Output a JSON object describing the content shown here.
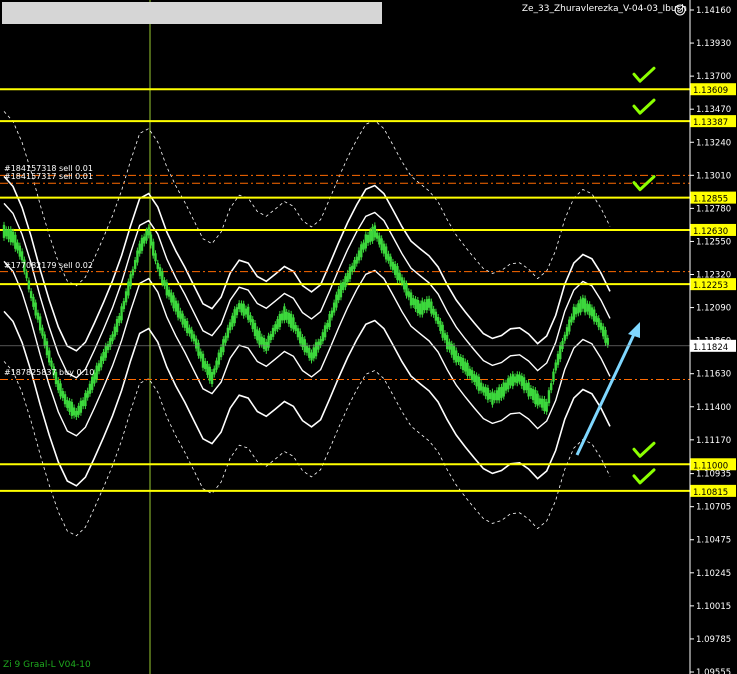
{
  "window": {
    "title": "Ze_33_Zhuravlerezka_V-04-03_Ibush",
    "indicator_label": "Zi 9 Graal-L V04-10"
  },
  "orders": [
    {
      "label": "#184157318 sell 0.01",
      "price": 1.1301
    },
    {
      "label": "#184157317 sell 0.01",
      "price": 1.12955
    },
    {
      "label": "#177082179 sell 0.02",
      "price": 1.1234
    },
    {
      "label": "#187825837 buy 0.10",
      "price": 1.1159
    }
  ],
  "price_axis": {
    "ticks": [
      "1.14160",
      "1.13930",
      "1.13700",
      "1.13470",
      "1.13240",
      "1.13010",
      "1.12780",
      "1.12550",
      "1.12320",
      "1.12090",
      "1.11860",
      "1.11630",
      "1.11400",
      "1.11170",
      "1.10935",
      "1.10705",
      "1.10475",
      "1.10245",
      "1.10015",
      "1.09785",
      "1.09555"
    ],
    "current_price": "1.11824"
  },
  "levels": [
    {
      "price": 1.13609,
      "label": "1.13609",
      "check": true
    },
    {
      "price": 1.13387,
      "label": "1.13387",
      "check": true
    },
    {
      "price": 1.12855,
      "label": "1.12855",
      "check": true
    },
    {
      "price": 1.1263,
      "label": "1.12630",
      "check": false
    },
    {
      "price": 1.12253,
      "label": "1.12253",
      "check": false
    },
    {
      "price": 1.11,
      "label": "1.11000",
      "check": true
    },
    {
      "price": 1.10815,
      "label": "1.10815",
      "check": true
    }
  ],
  "colors": {
    "background": "#000000",
    "candle": "#3cd83c",
    "level_line": "#ffff00",
    "level_label_bg": "#ffff00",
    "band": "#ffffff",
    "order_line": "#ff6a00",
    "arrow": "#7fd7ff",
    "checkmark": "#8cff00",
    "vline": "#9acd32"
  },
  "chart_data": {
    "type": "line",
    "title": "",
    "ylabel": "",
    "ylim": [
      1.09555,
      1.1416
    ],
    "series": [
      {
        "values": [
          1.1262,
          1.1258,
          1.1245,
          1.1218,
          1.1198,
          1.1175,
          1.1155,
          1.1142,
          1.1135,
          1.1145,
          1.116,
          1.1175,
          1.1188,
          1.1205,
          1.1228,
          1.125,
          1.1262,
          1.1238,
          1.1222,
          1.121,
          1.1198,
          1.1188,
          1.1172,
          1.116,
          1.1178,
          1.1196,
          1.121,
          1.1205,
          1.119,
          1.1182,
          1.1195,
          1.1205,
          1.1198,
          1.1185,
          1.1175,
          1.1185,
          1.12,
          1.1218,
          1.123,
          1.1242,
          1.1255,
          1.1262,
          1.125,
          1.1238,
          1.1228,
          1.1215,
          1.1208,
          1.1212,
          1.12,
          1.1185,
          1.1175,
          1.1168,
          1.116,
          1.1152,
          1.1146,
          1.115,
          1.1158,
          1.116,
          1.1152,
          1.1145,
          1.114,
          1.1168,
          1.1188,
          1.1205,
          1.1212,
          1.1206,
          1.1196,
          1.1182
        ]
      }
    ]
  }
}
